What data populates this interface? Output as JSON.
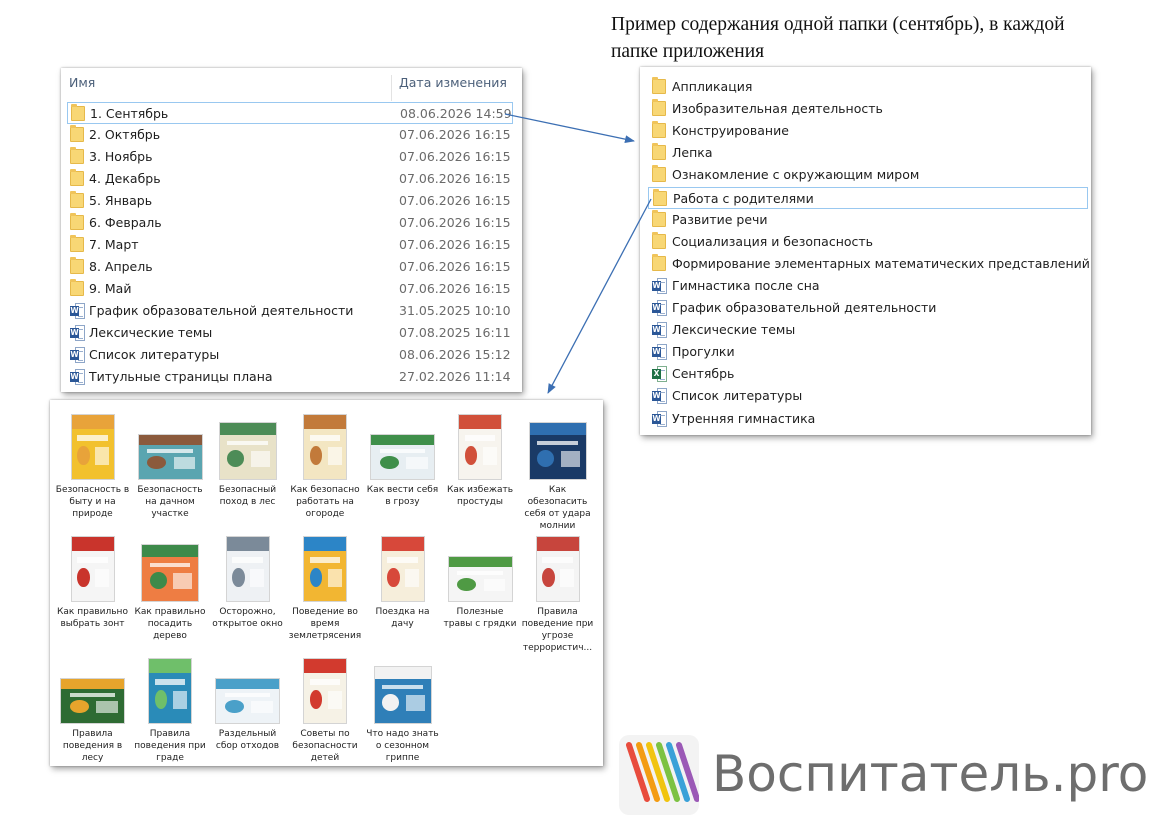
{
  "caption": {
    "line1": "Пример содержания одной папки (сентябрь), в каждой",
    "line2": "папке приложения"
  },
  "explorer_left": {
    "headers": {
      "name": "Имя",
      "date": "Дата изменения"
    },
    "items": [
      {
        "icon": "folder-icon",
        "name": "1. Сентябрь",
        "date": "08.06.2026 14:59",
        "selected": true
      },
      {
        "icon": "folder-icon",
        "name": "2. Октябрь",
        "date": "07.06.2026 16:15"
      },
      {
        "icon": "folder-icon",
        "name": "3. Ноябрь",
        "date": "07.06.2026 16:15"
      },
      {
        "icon": "folder-icon",
        "name": "4. Декабрь",
        "date": "07.06.2026 16:15"
      },
      {
        "icon": "folder-icon",
        "name": "5. Январь",
        "date": "07.06.2026 16:15"
      },
      {
        "icon": "folder-icon",
        "name": "6. Февраль",
        "date": "07.06.2026 16:15"
      },
      {
        "icon": "folder-icon",
        "name": "7. Март",
        "date": "07.06.2026 16:15"
      },
      {
        "icon": "folder-icon",
        "name": "8. Апрель",
        "date": "07.06.2026 16:15"
      },
      {
        "icon": "folder-icon",
        "name": "9. Май",
        "date": "07.06.2026 16:15"
      },
      {
        "icon": "word-doc-icon",
        "name": "График образовательной деятельности",
        "date": "31.05.2025 10:10"
      },
      {
        "icon": "word-doc-icon",
        "name": "Лексические темы",
        "date": "07.08.2025 16:11"
      },
      {
        "icon": "word-doc-icon",
        "name": "Список литературы",
        "date": "08.06.2026 15:12"
      },
      {
        "icon": "word-doc-icon",
        "name": "Титульные страницы плана",
        "date": "27.02.2026 11:14"
      }
    ]
  },
  "explorer_right": {
    "items": [
      {
        "icon": "folder-icon",
        "name": "Аппликация"
      },
      {
        "icon": "folder-icon",
        "name": "Изобразительная деятельность"
      },
      {
        "icon": "folder-icon",
        "name": "Конструирование"
      },
      {
        "icon": "folder-icon",
        "name": "Лепка"
      },
      {
        "icon": "folder-icon",
        "name": "Ознакомление с окружающим миром"
      },
      {
        "icon": "folder-icon",
        "name": "Работа с родителями",
        "selected": true
      },
      {
        "icon": "folder-icon",
        "name": "Развитие речи"
      },
      {
        "icon": "folder-icon",
        "name": "Социализация и безопасность"
      },
      {
        "icon": "folder-icon",
        "name": "Формирование элементарных математических представлений"
      },
      {
        "icon": "word-doc-icon",
        "name": "Гимнастика после сна"
      },
      {
        "icon": "word-doc-icon",
        "name": "График образовательной деятельности"
      },
      {
        "icon": "word-doc-icon",
        "name": "Лексические темы"
      },
      {
        "icon": "word-doc-icon",
        "name": "Прогулки"
      },
      {
        "icon": "excel-doc-icon",
        "name": "Сентябрь"
      },
      {
        "icon": "word-doc-icon",
        "name": "Список литературы"
      },
      {
        "icon": "word-doc-icon",
        "name": "Утренняя гимнастика"
      }
    ]
  },
  "thumbnails": [
    {
      "label": "Безопасность в быту и на природе",
      "colors": [
        "#f2c12e",
        "#e8a33a"
      ],
      "shape": "portrait"
    },
    {
      "label": "Безопасность на дачном участке",
      "colors": [
        "#5aa5b0",
        "#8b5a3c"
      ],
      "shape": "landscape"
    },
    {
      "label": "Безопасный поход в лес",
      "colors": [
        "#e8e2c8",
        "#4d8c57"
      ],
      "shape": "square"
    },
    {
      "label": "Как безопасно работать на огороде",
      "colors": [
        "#f3e6c2",
        "#c27a3a"
      ],
      "shape": "portrait"
    },
    {
      "label": "Как вести себя в грозу",
      "colors": [
        "#e7eef2",
        "#3f8f4a"
      ],
      "shape": "landscape"
    },
    {
      "label": "Как избежать простуды",
      "colors": [
        "#f7f4ee",
        "#d1503a"
      ],
      "shape": "portrait"
    },
    {
      "label": "Как обезопасить себя от удара молнии",
      "colors": [
        "#1a3a66",
        "#2f6fb0"
      ],
      "shape": "square"
    },
    {
      "label": "Как правильно выбрать зонт",
      "colors": [
        "#f5f5f5",
        "#c9342c"
      ],
      "shape": "portrait"
    },
    {
      "label": "Как правильно посадить дерево",
      "colors": [
        "#ee7d43",
        "#3d8a4a"
      ],
      "shape": "square"
    },
    {
      "label": "Осторожно, открытое окно",
      "colors": [
        "#eef1f4",
        "#7b8a99"
      ],
      "shape": "portrait"
    },
    {
      "label": "Поведение во время землетрясения",
      "colors": [
        "#f2b632",
        "#2c85c7"
      ],
      "shape": "portrait"
    },
    {
      "label": "Поездка на дачу",
      "colors": [
        "#f6eedb",
        "#d7483a"
      ],
      "shape": "portrait"
    },
    {
      "label": "Полезные травы с грядки",
      "colors": [
        "#f5f5f5",
        "#4f9a44"
      ],
      "shape": "landscape"
    },
    {
      "label": "Правила поведение при угрозе террористич...",
      "colors": [
        "#f4f4f4",
        "#c7453d"
      ],
      "shape": "portrait"
    },
    {
      "label": "Правила поведения в лесу",
      "colors": [
        "#2e6b33",
        "#e6a42c"
      ],
      "shape": "landscape"
    },
    {
      "label": "Правила поведения при граде",
      "colors": [
        "#2a8bb8",
        "#6fbf6a"
      ],
      "shape": "portrait"
    },
    {
      "label": "Раздельный сбор отходов",
      "colors": [
        "#eef3f7",
        "#4aa0c9"
      ],
      "shape": "landscape"
    },
    {
      "label": "Советы по безопасности детей",
      "colors": [
        "#f6f2e6",
        "#d23a2e"
      ],
      "shape": "portrait"
    },
    {
      "label": "Что надо знать о сезонном гриппе",
      "colors": [
        "#2f7fb8",
        "#f2f2f2"
      ],
      "shape": "square"
    }
  ],
  "brand": {
    "text": "Воспитатель.pro",
    "logo_icon": "pencils-logo-icon",
    "logo_colors": [
      "#e84c3d",
      "#f39c12",
      "#f1c40f",
      "#7dc242",
      "#3aa1d8",
      "#9b59b6"
    ]
  },
  "arrow_color": "#3c6fb3"
}
